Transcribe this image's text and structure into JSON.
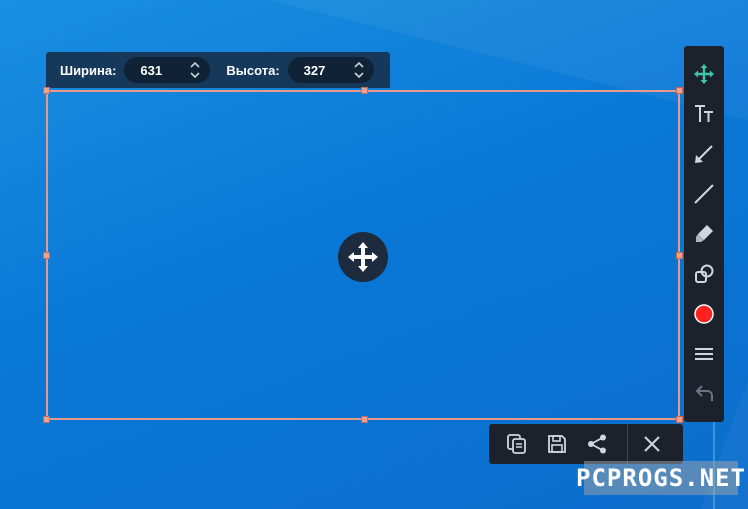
{
  "size_bar": {
    "width_label": "Ширина:",
    "width_value": "631",
    "height_label": "Высота:",
    "height_value": "327"
  },
  "toolbar": {
    "items": [
      "move-icon",
      "text-icon",
      "arrow-icon",
      "line-icon",
      "marker-icon",
      "shapes-icon",
      "color-swatch",
      "line-width-icon",
      "undo-icon"
    ],
    "active_color": "#3ec6a8",
    "pen_color": "#ff2020"
  },
  "action_bar": {
    "items": [
      "copy-icon",
      "save-icon",
      "share-icon",
      "close-icon"
    ]
  },
  "colors": {
    "frame": "#e8998a",
    "panel": "#1b222c"
  },
  "watermark": {
    "text": "PCPROGS.NET"
  }
}
